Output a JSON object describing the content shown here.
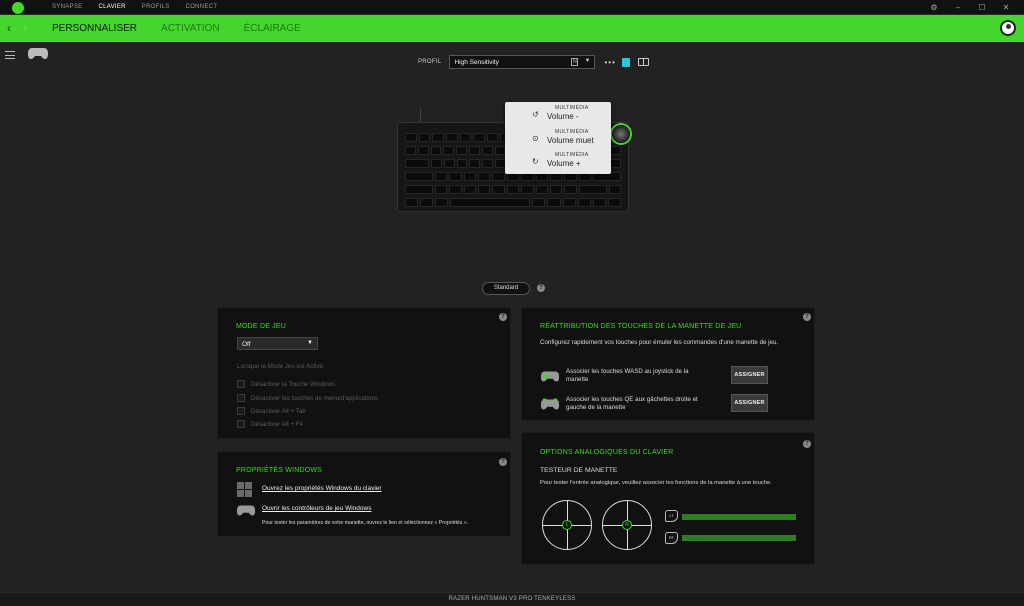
{
  "topnav": {
    "items": [
      "SYNAPSE",
      "CLAVIER",
      "PROFILS",
      "CONNECT"
    ],
    "active": "CLAVIER"
  },
  "tabs": [
    "PERSONNALISER",
    "ACTIVATION",
    "ÉCLAIRAGE"
  ],
  "profile": {
    "label": "PROFIL",
    "value": "High Sensitivity"
  },
  "popup": {
    "entries": [
      {
        "category": "MULTIMÉDIA",
        "value": "Volume -",
        "icon": "rotate-left-icon"
      },
      {
        "category": "MULTIMÉDIA",
        "value": "Volume muet",
        "icon": "press-icon"
      },
      {
        "category": "MULTIMÉDIA",
        "value": "Volume +",
        "icon": "rotate-right-icon"
      }
    ]
  },
  "mode_selector": "Standard",
  "game_mode": {
    "title": "MODE DE JEU",
    "dropdown_value": "Off",
    "when_active": "Lorsque le Mode Jeu est Activé:",
    "options": [
      "Désactiver la Touche Windows",
      "Désactiver les touches de menu/d'applications",
      "Désactiver Alt + Tab",
      "Désactiver Alt + F4"
    ]
  },
  "windows_props": {
    "title": "PROPRIÉTÉS WINDOWS",
    "link1": "Ouvrez les propriétés Windows du clavier",
    "link2": "Ouvrir les contrôleurs de jeu Windows",
    "note": "Pour tester les paramètres de votre manette, ouvrez le lien et sélectionnez « Propriétés »."
  },
  "remap": {
    "title": "RÉATTRIBUTION DES TOUCHES DE LA MANETTE DE JEU",
    "description": "Configurez rapidement vos touches pour émuler les commandes d'une manette de jeu.",
    "item1": "Associer les touches WASD au joystick de la manette",
    "item2": "Associer les touches QE aux gâchettes droite et gauche de la manette",
    "button": "ASSIGNER"
  },
  "analog": {
    "title": "OPTIONS ANALOGIQUES DU CLAVIER",
    "subtitle": "TESTEUR DE MANETTE",
    "description": "Pour tester l'entrée analogique, veuillez associer les fonctions de la manette à une touche.",
    "stick_left": "L",
    "stick_right": "R",
    "trigger_left": "LT",
    "trigger_right": "RT"
  },
  "status": "RAZER HUNTSMAN V3 PRO TENKEYLESS",
  "colors": {
    "accent": "#44d62c",
    "background": "#222222",
    "panel": "#111111"
  }
}
